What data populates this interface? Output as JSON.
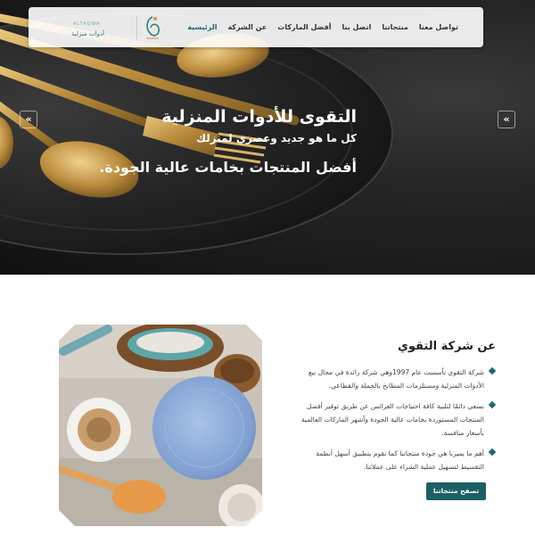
{
  "nav": {
    "items": [
      {
        "label": "الرئيسية",
        "active": true
      },
      {
        "label": "عن الشركة",
        "active": false
      },
      {
        "label": "أفضل الماركات",
        "active": false
      },
      {
        "label": "اتصل بنا",
        "active": false
      },
      {
        "label": "منتجاتنا",
        "active": false
      },
      {
        "label": "تواصل معنا",
        "active": false
      }
    ]
  },
  "logo": {
    "text_en": "ALTAQWA",
    "text_ar": "أدوات منزلية"
  },
  "hero": {
    "title": "التقوى للأدوات المنزلية",
    "subtitle": "كل ما هو جديد وعصري لمنزلك",
    "tagline": "أفضل المنتجات بخامات عالية الجودة.",
    "prev_icon": "«",
    "next_icon": "«"
  },
  "about": {
    "heading": "عن شركة التقوي",
    "items": [
      "شركة التقوى تأسست عام 1997وهي شركة رائدة في مجال بيع الأدوات المنزلية ومستلزمات المطابخ بالجملة والقطاعي.",
      "نسعى دائمًا لتلبية كافة احتياجات العرائس عن طريق توفير أفضل المنتجات المستوردة بخامات عالية الجودة وأشهر الماركات العالمية بأسعار منافسة.",
      "أهم ما يميزنا هي جودة منتجاتنا كما نقوم بتطبيق أسهل أنظمة التقسيط لتسهيل عملية الشراء على عملائنا."
    ],
    "button_label": "تصفح منتجاتنا"
  },
  "colors": {
    "accent": "#1d6b6b",
    "button": "#1d5f63",
    "gold": "#c9a04a"
  }
}
